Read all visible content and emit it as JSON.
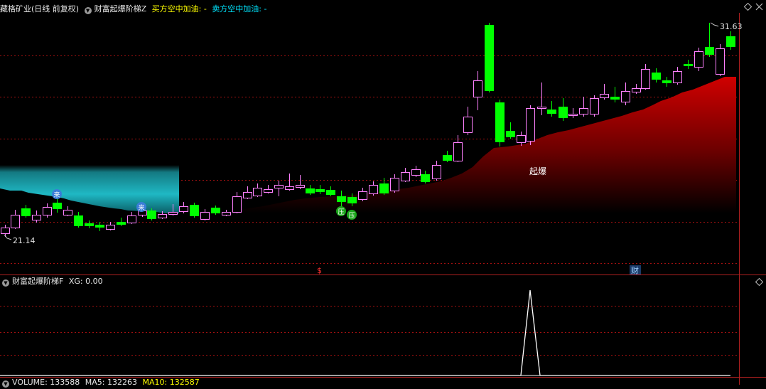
{
  "header": {
    "stock_name": "藏格矿业",
    "period": "(日线 前复权)",
    "indicator_name": "财富起爆阶梯Z",
    "buy_label": "买方空中加油: -",
    "sell_label": "卖方空中加油: -"
  },
  "sub_header": {
    "indicator_name": "财富起爆阶梯F",
    "xg_label": "XG: 0.00"
  },
  "bottom_header": {
    "volume_label": "VOLUME: 133588",
    "ma5_label": "MA5: 132263",
    "ma10_label": "MA10: 132587"
  },
  "annotations": {
    "high_price": "31.63",
    "low_price": "21.14",
    "qibao_label": "起爆",
    "ya_label": "压",
    "lai_label": "来",
    "money_marker": "$",
    "cai_marker": "财"
  },
  "colors": {
    "up_candle": "#ff80ff",
    "down_candle": "#00ff00",
    "band_red": "#cc0000",
    "band_teal": "#1fb8c4",
    "grid": "#a01010",
    "buy_text": "#ffff00",
    "sell_text": "#00e6ff"
  },
  "chart_data": {
    "type": "candlestick",
    "y_range": [
      21.14,
      31.63
    ],
    "xg_signal": {
      "values": [
        0,
        1,
        0
      ],
      "peak_index": 1
    }
  }
}
